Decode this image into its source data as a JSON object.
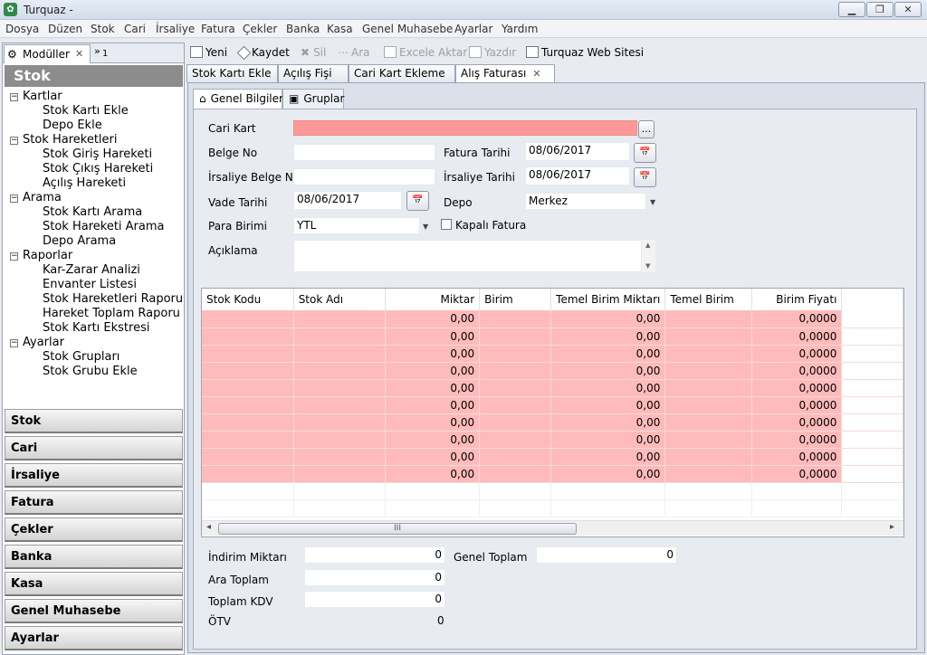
{
  "window": {
    "title": "Turquaz -",
    "min": "▁",
    "max": "❐",
    "close": "✕"
  },
  "menu": [
    "Dosya",
    "Düzen",
    "Stok",
    "Cari",
    "İrsaliye",
    "Fatura",
    "Çekler",
    "Banka",
    "Kasa",
    "Genel Muhasebe",
    "Ayarlar",
    "Yardım"
  ],
  "left": {
    "tab_label": "Modüller",
    "tab2_label": "1",
    "header": "Stok",
    "tree": [
      {
        "label": "Kartlar",
        "level": 0
      },
      {
        "label": "Stok Kartı Ekle",
        "level": 1
      },
      {
        "label": "Depo Ekle",
        "level": 1
      },
      {
        "label": "Stok Hareketleri",
        "level": 0
      },
      {
        "label": "Stok Giriş Hareketi",
        "level": 1
      },
      {
        "label": "Stok Çıkış Hareketi",
        "level": 1
      },
      {
        "label": "Açılış Hareketi",
        "level": 1
      },
      {
        "label": "Arama",
        "level": 0
      },
      {
        "label": "Stok Kartı Arama",
        "level": 1
      },
      {
        "label": "Stok Hareketi Arama",
        "level": 1
      },
      {
        "label": "Depo Arama",
        "level": 1
      },
      {
        "label": "Raporlar",
        "level": 0
      },
      {
        "label": "Kar-Zarar Analizi",
        "level": 1
      },
      {
        "label": "Envanter Listesi",
        "level": 1
      },
      {
        "label": "Stok Hareketleri Raporu",
        "level": 1
      },
      {
        "label": "Hareket Toplam Raporu",
        "level": 1
      },
      {
        "label": "Stok Kartı Ekstresi",
        "level": 1
      },
      {
        "label": "Ayarlar",
        "level": 0
      },
      {
        "label": "Stok Grupları",
        "level": 1
      },
      {
        "label": "Stok Grubu Ekle",
        "level": 1
      }
    ],
    "nav": [
      "Stok",
      "Cari",
      "İrsaliye",
      "Fatura",
      "Çekler",
      "Banka",
      "Kasa",
      "Genel Muhasebe",
      "Ayarlar"
    ]
  },
  "toolbar": {
    "new": "Yeni",
    "save": "Kaydet",
    "delete": "Sil",
    "search": "Ara",
    "excel": "Excele Aktar",
    "print": "Yazdır",
    "web": "Turquaz Web Sitesi"
  },
  "doc_tabs": [
    "Stok Kartı Ekle",
    "Açılış Fişi",
    "Cari Kart Ekleme",
    "Alış Faturası"
  ],
  "sub_tabs": [
    "Genel Bilgiler",
    "Gruplar"
  ],
  "form": {
    "cari_kart": "Cari Kart",
    "cari_btn": "...",
    "belge_no": "Belge No",
    "fatura_tarihi": "Fatura Tarihi",
    "fatura_tarihi_val": "08/06/2017",
    "irsaliye_belge_no": "İrsaliye Belge No",
    "irsaliye_tarihi": "İrsaliye Tarihi",
    "irsaliye_tarihi_val": "08/06/2017",
    "vade_tarihi": "Vade Tarihi",
    "vade_tarihi_val": "08/06/2017",
    "depo": "Depo",
    "depo_val": "Merkez",
    "para_birimi": "Para Birimi",
    "para_birimi_val": "YTL",
    "kapali_fatura": "Kapalı Fatura",
    "aciklama": "Açıklama"
  },
  "grid": {
    "columns": [
      "Stok Kodu",
      "Stok Adı",
      "Miktar",
      "Birim",
      "Temel Birim Miktarı",
      "Temel Birim",
      "Birim Fiyatı"
    ],
    "rows": [
      [
        "",
        "",
        "0,00",
        "",
        "0,00",
        "",
        "0,0000"
      ],
      [
        "",
        "",
        "0,00",
        "",
        "0,00",
        "",
        "0,0000"
      ],
      [
        "",
        "",
        "0,00",
        "",
        "0,00",
        "",
        "0,0000"
      ],
      [
        "",
        "",
        "0,00",
        "",
        "0,00",
        "",
        "0,0000"
      ],
      [
        "",
        "",
        "0,00",
        "",
        "0,00",
        "",
        "0,0000"
      ],
      [
        "",
        "",
        "0,00",
        "",
        "0,00",
        "",
        "0,0000"
      ],
      [
        "",
        "",
        "0,00",
        "",
        "0,00",
        "",
        "0,0000"
      ],
      [
        "",
        "",
        "0,00",
        "",
        "0,00",
        "",
        "0,0000"
      ],
      [
        "",
        "",
        "0,00",
        "",
        "0,00",
        "",
        "0,0000"
      ],
      [
        "",
        "",
        "0,00",
        "",
        "0,00",
        "",
        "0,0000"
      ]
    ],
    "scroll_grip": "III",
    "scroll_left": "◂",
    "scroll_right": "▸"
  },
  "totals": {
    "indirim": "İndirim Miktarı",
    "indirim_val": "0",
    "genel": "Genel Toplam",
    "genel_val": "0",
    "ara": "Ara Toplam",
    "ara_val": "0",
    "kdv": "Toplam KDV",
    "kdv_val": "0",
    "otv": "ÖTV",
    "otv_val": "0"
  }
}
